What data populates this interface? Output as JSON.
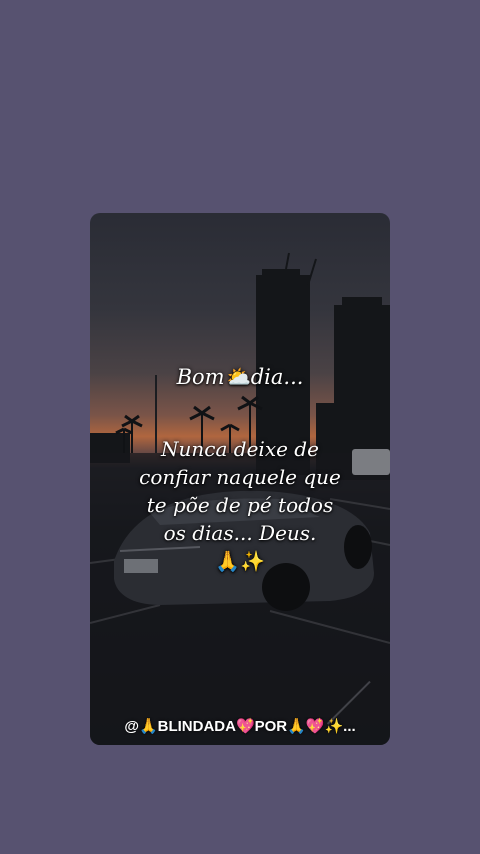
{
  "status": {
    "greeting": "Bom⛅dia...",
    "message_lines": [
      "Nunca deixe de",
      "confiar naquele que",
      "te põe de pé todos",
      "os dias... Deus."
    ],
    "emoji_line": "🙏✨",
    "credit": "@🙏BLINDADA💖POR🙏💖✨..."
  },
  "colors": {
    "background": "#575270",
    "text": "#ffffff",
    "sunset": "#b0663f"
  }
}
